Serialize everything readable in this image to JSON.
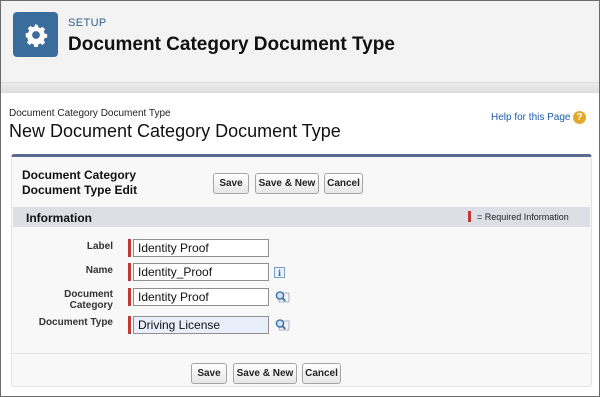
{
  "header": {
    "section_label": "SETUP",
    "title": "Document Category Document Type",
    "icon": "gear-icon"
  },
  "page": {
    "breadcrumb": "Document Category Document Type",
    "title": "New Document Category Document Type",
    "help_link": "Help for this Page",
    "help_icon_glyph": "?"
  },
  "panel": {
    "title": "Document Category Document Type Edit",
    "buttons": {
      "save": "Save",
      "save_new": "Save & New",
      "cancel": "Cancel"
    },
    "section_title": "Information",
    "required_legend": "= Required Information"
  },
  "fields": [
    {
      "label": "Label",
      "value": "Identity Proof",
      "addon": "none"
    },
    {
      "label": "Name",
      "value": "Identity_Proof",
      "addon": "info-icon"
    },
    {
      "label": "Document Category",
      "value": "Identity Proof",
      "addon": "lookup-icon"
    },
    {
      "label": "Document Type",
      "value": "Driving License",
      "addon": "lookup-icon"
    }
  ],
  "info_glyph": "i",
  "colors": {
    "header_icon_bg": "#3b6d9c",
    "required": "#c23934",
    "panel_accent": "#5b6b8c",
    "link": "#1b5bab"
  }
}
